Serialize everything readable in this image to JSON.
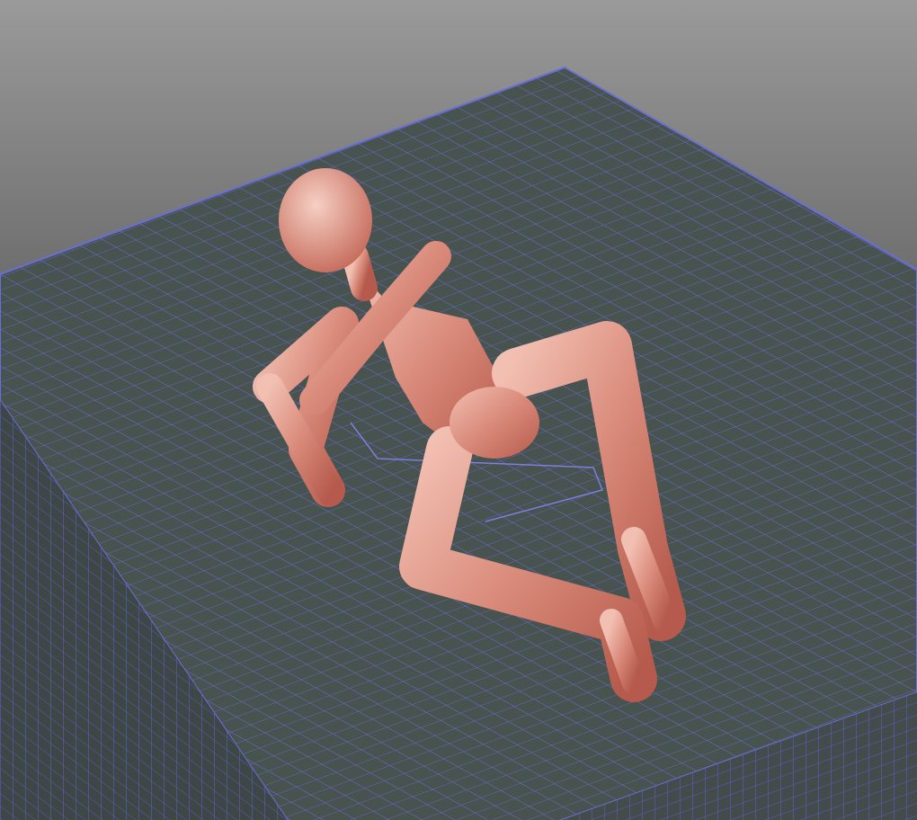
{
  "viewport": {
    "kind": "render"
  }
}
